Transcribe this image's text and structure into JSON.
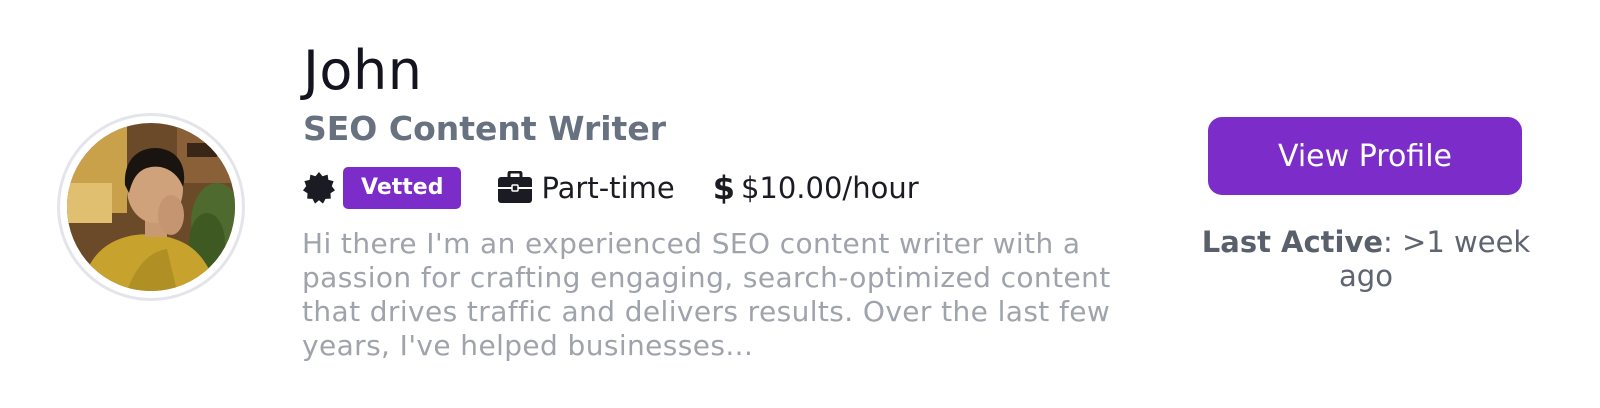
{
  "profile": {
    "name": "John",
    "title": "SEO Content Writer",
    "badge": "Vetted",
    "employment_type": "Part-time",
    "rate_symbol": "$",
    "rate": "$10.00/hour",
    "description": "Hi there I'm an experienced SEO content writer with a passion for crafting engaging, search-optimized content that drives traffic and delivers results. Over the last few years, I've helped businesses..."
  },
  "actions": {
    "view_profile_label": "View Profile"
  },
  "activity": {
    "label": "Last Active",
    "separator": ": ",
    "value": ">1 week ago"
  },
  "icons": {
    "badge": "seal-icon",
    "employment": "briefcase-icon",
    "rate": "dollar-icon"
  },
  "colors": {
    "accent": "#7b2cc9",
    "title": "#687180",
    "description": "#9fa3ab",
    "text": "#1b1b24"
  }
}
